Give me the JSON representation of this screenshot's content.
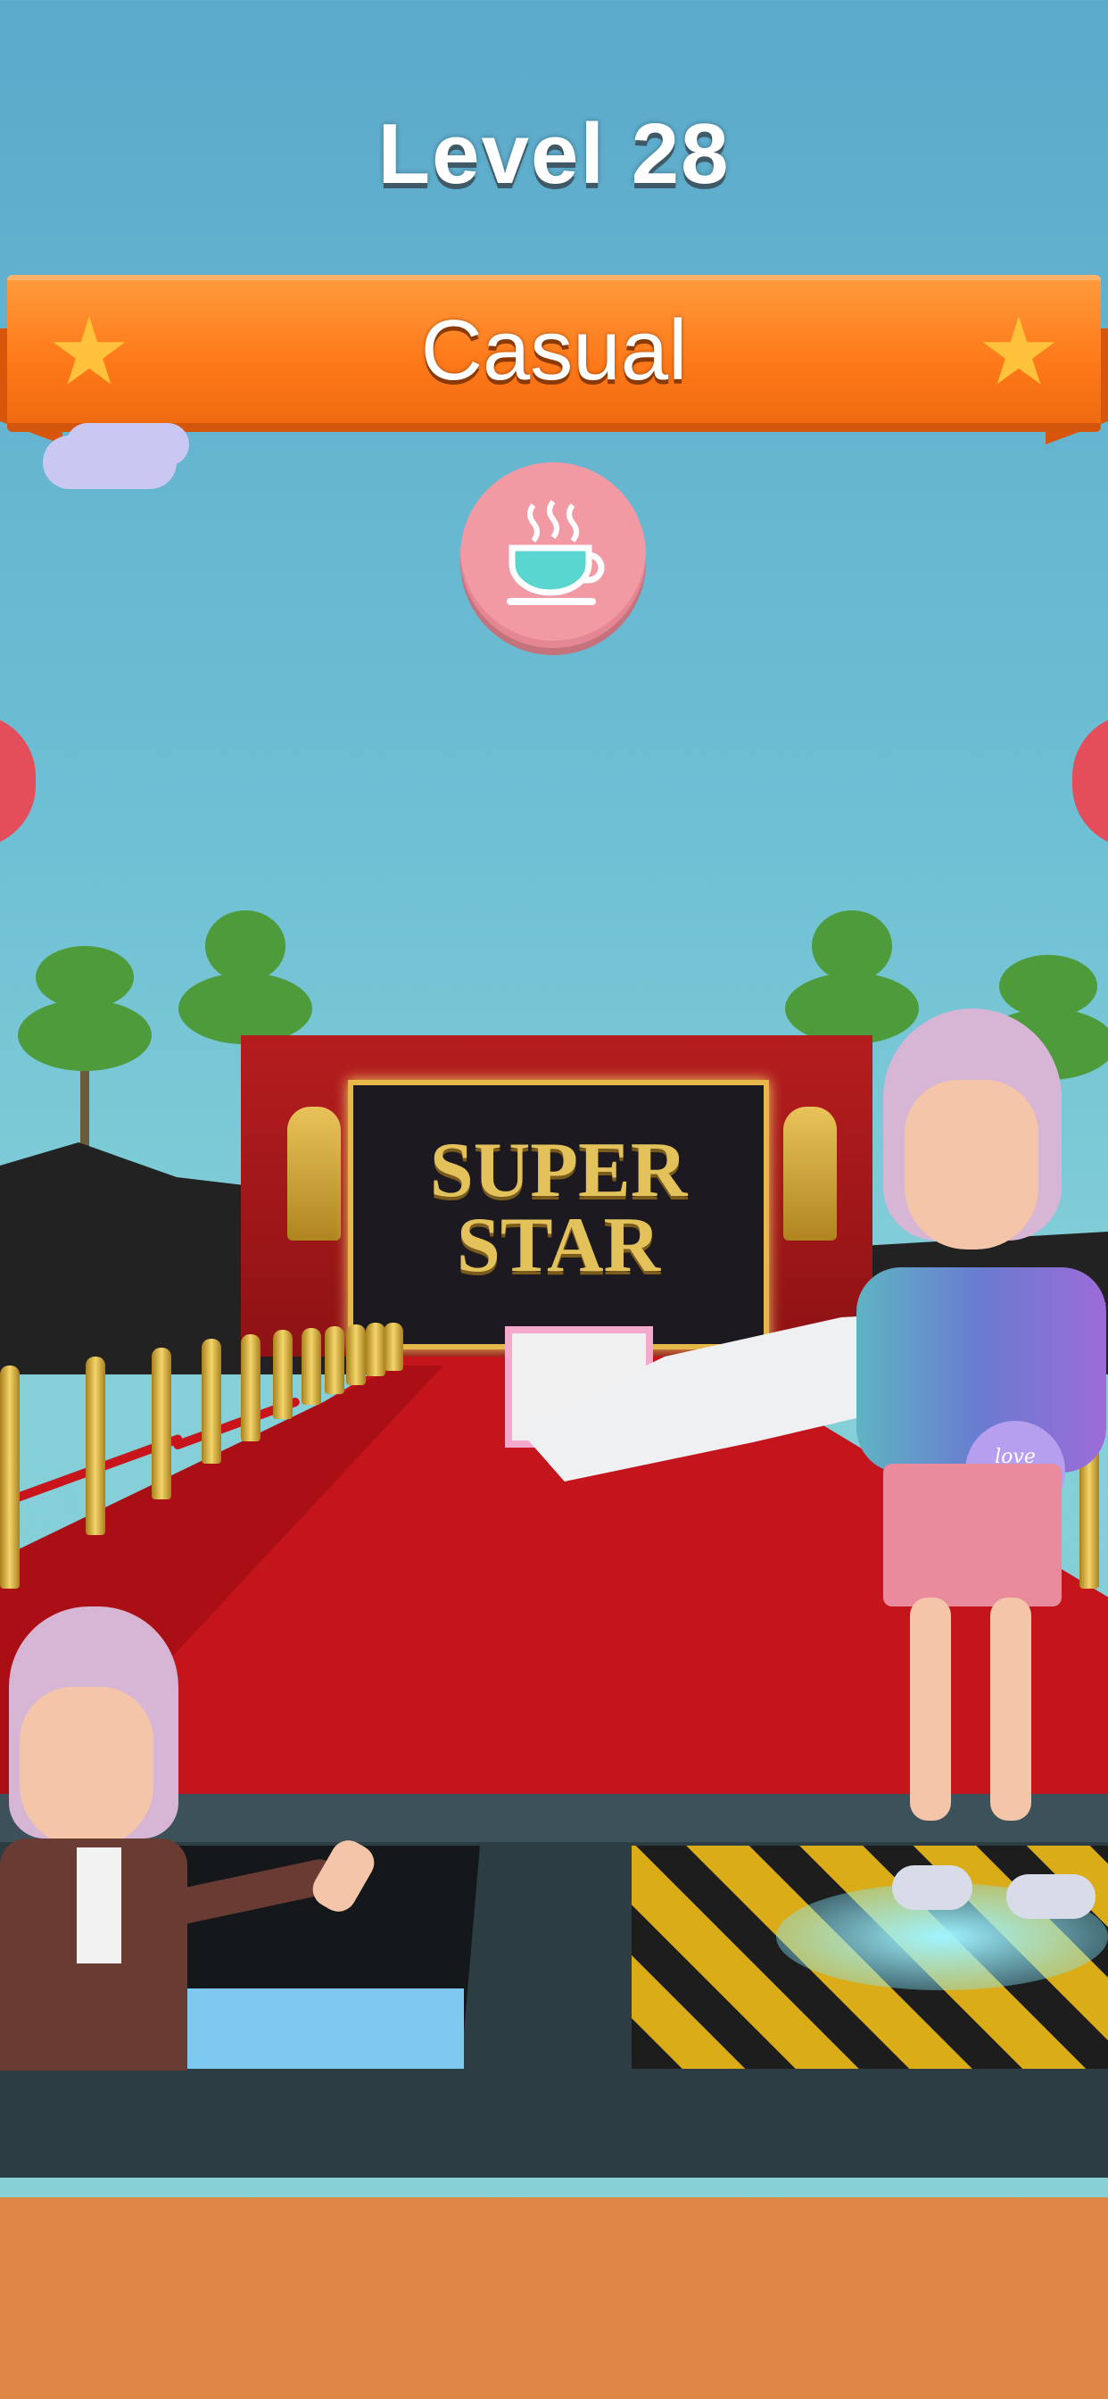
{
  "hud": {
    "level_title": "Level 28",
    "category": "Casual",
    "category_icon": "coffee-cup-icon",
    "accent_colors": {
      "banner": "#ff7a1a",
      "icon_bg": "#f29aa4",
      "star": "#ffc23a"
    }
  },
  "scene": {
    "backdrop_text_line1": "SUPER",
    "backdrop_text_line2": "STAR",
    "bag_text": "love mode"
  }
}
